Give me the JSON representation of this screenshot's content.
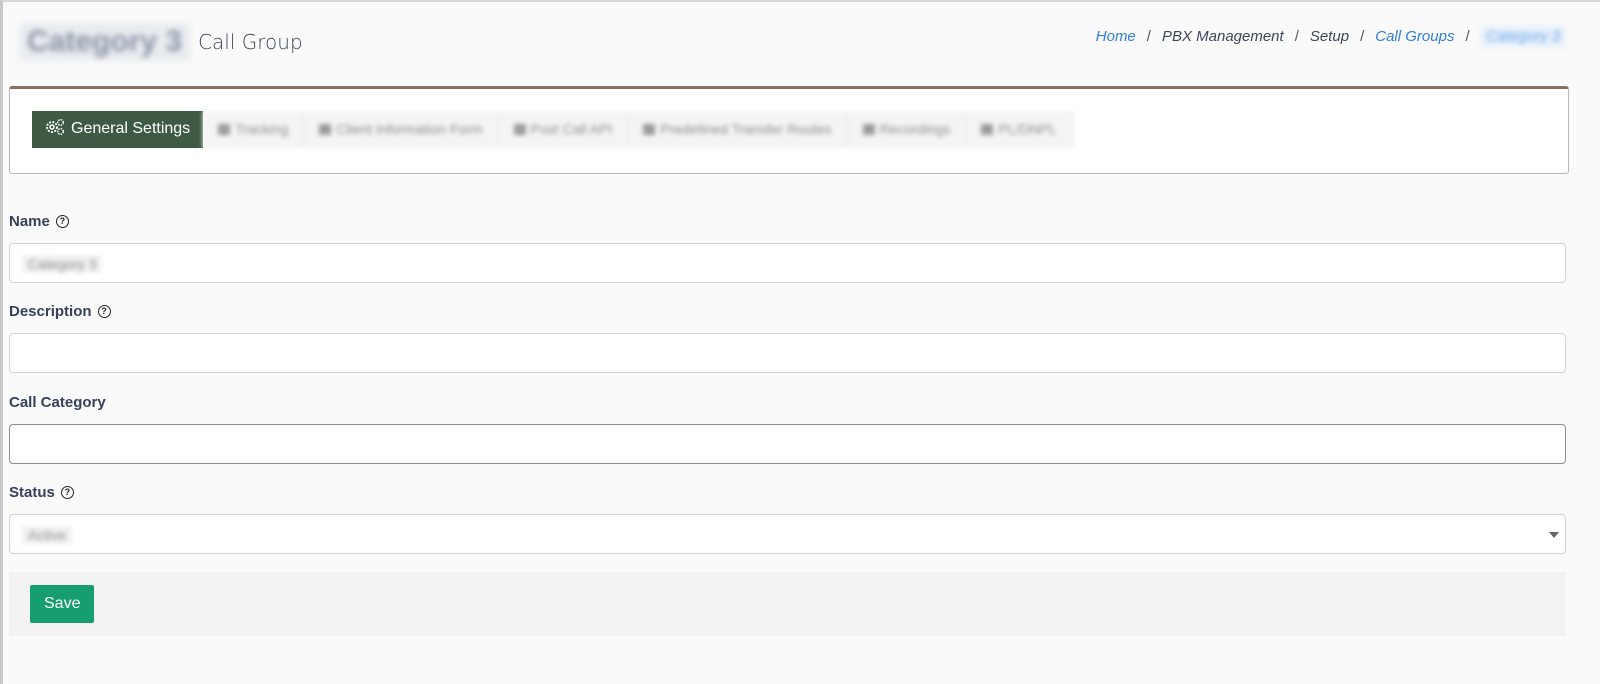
{
  "header": {
    "title_prefix": "Category 3",
    "title": "Call Group"
  },
  "breadcrumb": {
    "items": [
      "Home",
      "PBX Management",
      "Setup",
      "Call Groups",
      "Category 3"
    ],
    "separator": "/"
  },
  "tabs": {
    "active": {
      "label": "General Settings",
      "icon": "gears-icon"
    },
    "others": [
      {
        "label": "Tracking"
      },
      {
        "label": "Client Information Form"
      },
      {
        "label": "Post Call API"
      },
      {
        "label": "Predefined Transfer Routes"
      },
      {
        "label": "Recordings"
      },
      {
        "label": "PL/DNPL"
      }
    ]
  },
  "form": {
    "name": {
      "label": "Name",
      "value": "Category 3",
      "help_icon": "question-circle-icon"
    },
    "description": {
      "label": "Description",
      "value": "",
      "help_icon": "question-circle-icon"
    },
    "call_category": {
      "label": "Call Category",
      "value": ""
    },
    "status": {
      "label": "Status",
      "selected": "Active",
      "help_icon": "question-circle-icon"
    }
  },
  "footer": {
    "save_label": "Save"
  },
  "colors": {
    "active_tab_bg": "#3e5a45",
    "save_button_bg": "#179e6e",
    "link": "#2f7ed8",
    "card_top_border": "#8c6f5f"
  }
}
